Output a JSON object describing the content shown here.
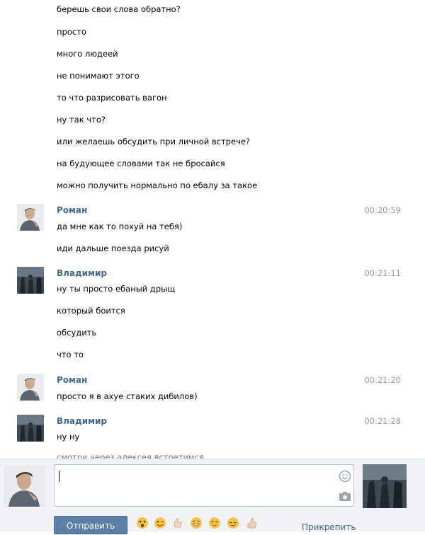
{
  "earlier_lines": [
    "берешь свои слова обратно?",
    "просто",
    "много людеей",
    "не понимают этого",
    "то что разрисовать вагон",
    "ну так что?",
    "или желаешь обсудить при личной встрече?",
    "на будующее словами так не бросайся",
    "можно получить нормально по ебалу за такое"
  ],
  "messages": [
    {
      "author": "Роман",
      "time": "00:20:59",
      "avatar": "roman-avatar",
      "lines": [
        "да мне как то похуй на тебя)",
        "иди дальше поезда рисуй"
      ]
    },
    {
      "author": "Владимир",
      "time": "00:21:11",
      "avatar": "vladimir-avatar",
      "lines": [
        "ну ты просто ебаный дрыщ",
        "который боится",
        "обсудить",
        "что то"
      ]
    },
    {
      "author": "Роман",
      "time": "00:21:20",
      "avatar": "roman-avatar",
      "lines": [
        "просто я в ахуе стаких дибилов)"
      ]
    },
    {
      "author": "Владимир",
      "time": "00:21:28",
      "avatar": "vladimir-avatar",
      "lines": [
        "ну ну"
      ]
    }
  ],
  "cut_off_line": "смотри через алексея встретимся",
  "composer": {
    "send_label": "Отправить",
    "attach_label": "Прикрепить",
    "input_value": ""
  },
  "icons": {
    "smile": "smile-icon",
    "camera": "camera-icon",
    "emoji_bar": [
      "scream-emoji",
      "wink-emoji",
      "thumb-emoji",
      "grin-emoji",
      "blush-emoji",
      "relieved-emoji",
      "thumbs-up-emoji"
    ]
  },
  "colors": {
    "author": "#45688e",
    "time": "#999999",
    "send_button": "#5b7fa6",
    "composer_bg": "#f0f2f5"
  }
}
